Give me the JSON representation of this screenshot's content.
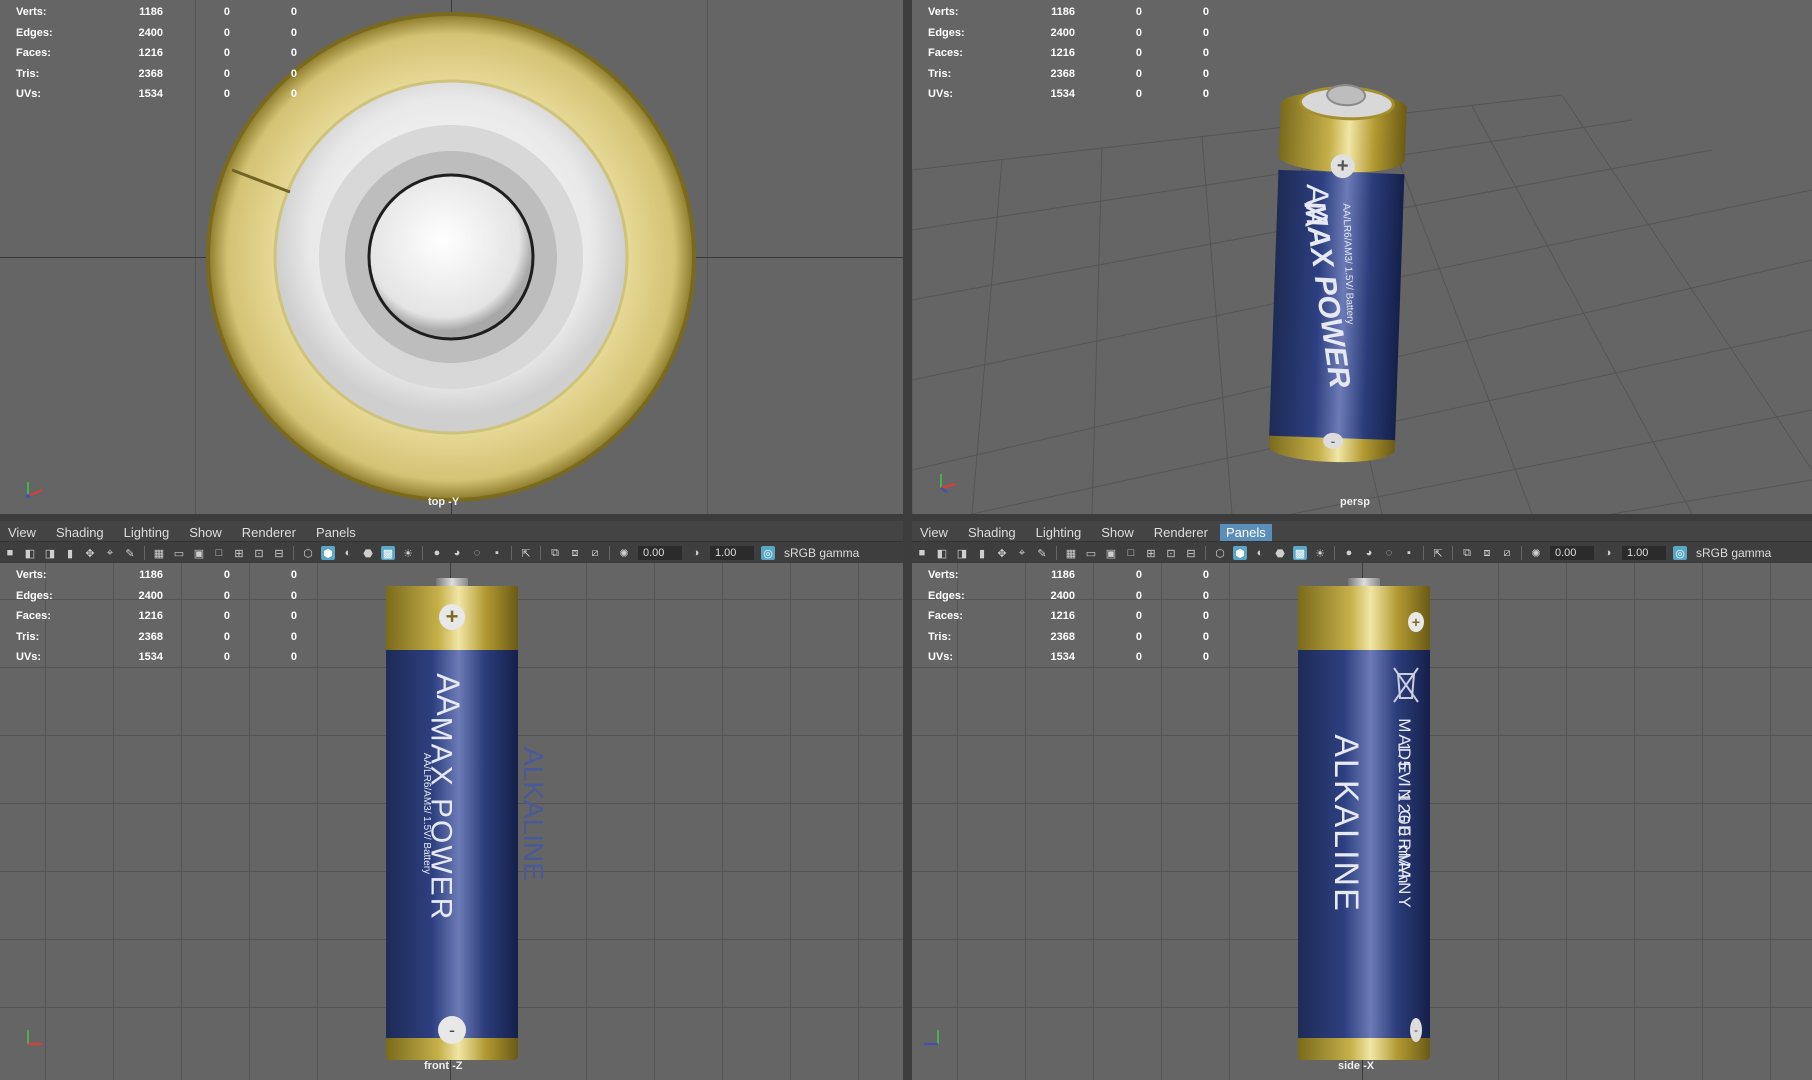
{
  "stats": {
    "rows": [
      {
        "label": "Verts:",
        "values": [
          "1186",
          "0",
          "0"
        ]
      },
      {
        "label": "Edges:",
        "values": [
          "2400",
          "0",
          "0"
        ]
      },
      {
        "label": "Faces:",
        "values": [
          "1216",
          "0",
          "0"
        ]
      },
      {
        "label": "Tris:",
        "values": [
          "2368",
          "0",
          "0"
        ]
      },
      {
        "label": "UVs:",
        "values": [
          "1534",
          "0",
          "0"
        ]
      }
    ]
  },
  "viewports": {
    "top": {
      "camera": "top -Y"
    },
    "persp": {
      "camera": "persp"
    },
    "front": {
      "camera": "front -Z"
    },
    "side": {
      "camera": "side -X"
    }
  },
  "menu": {
    "items": [
      "View",
      "Shading",
      "Lighting",
      "Show",
      "Renderer",
      "Panels"
    ],
    "active_right": "Panels"
  },
  "toolbar": {
    "exposure": "0.00",
    "gamma_value": "1.00",
    "color_space": "sRGB gamma"
  },
  "battery_text": {
    "cap_symbol_plus": "+",
    "cap_symbol_minus": "-",
    "size": "AA",
    "brand": "MAX POWER",
    "spec": "AA/LR6/AM3/ 1.5V/ Battery",
    "type": "ALKALINE",
    "origin": "MADE IN GERMANY",
    "rating": "1.5V 1200 mAh"
  },
  "colors": {
    "viewport_bg": "#656565",
    "active_accent": "#5b8fb9",
    "battery_blue": "#2d3f80",
    "battery_gold": "#c6b04a"
  }
}
